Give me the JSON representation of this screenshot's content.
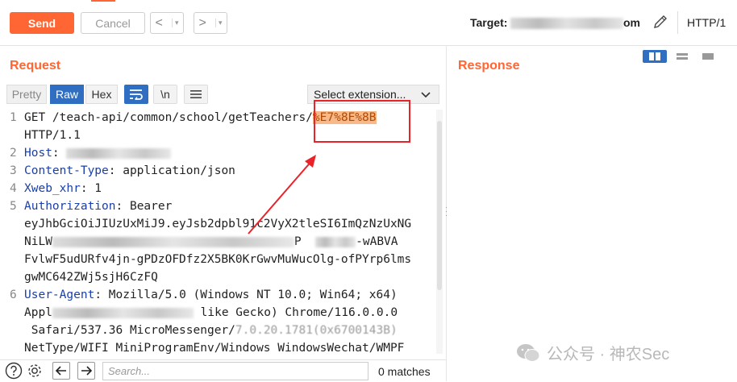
{
  "toolbar": {
    "send_label": "Send",
    "cancel_label": "Cancel",
    "back_glyph": "<",
    "forward_glyph": ">",
    "dropdown_glyph": "▾",
    "target_label": "Target:",
    "target_visible_suffix": "om",
    "http_version": "HTTP/1"
  },
  "layout_toggles": [
    "side-by-side",
    "top-bottom",
    "single"
  ],
  "request": {
    "title": "Request",
    "tabs": {
      "pretty": "Pretty",
      "raw": "Raw",
      "hex": "Hex"
    },
    "active_tab": "Raw",
    "newline_label": "\\n",
    "select_extension": "Select extension...",
    "lines": [
      {
        "num": "1",
        "parts": [
          "GET /teach-api/common/school/getTeachers/",
          "%E7%8E%8B"
        ]
      },
      {
        "num": "",
        "text": "HTTP/1.1"
      },
      {
        "num": "2",
        "header": "Host",
        "value": ":"
      },
      {
        "num": "3",
        "header": "Content-Type",
        "value": ": application/json"
      },
      {
        "num": "4",
        "header": "Xweb_xhr",
        "value": ": 1"
      },
      {
        "num": "5",
        "header": "Authorization",
        "value": ": Bearer"
      },
      {
        "num": "",
        "text": "eyJhbGciOiJIUzUxMiJ9.eyJsb2dpbl91c2VyX2tleSI6ImQzNzUxNG"
      },
      {
        "num": "",
        "text_start": "NiLW",
        "text_end": "P  ",
        "text_tail": "-wABVA"
      },
      {
        "num": "",
        "text": "FvlwF5udURfv4jn-gPDzOFDfz2X5BK0KrGwvMuWucOlg-ofPYrp6lms"
      },
      {
        "num": "",
        "text": "gwMC642ZWj5sjH6CzFQ"
      },
      {
        "num": "6",
        "header": "User-Agent",
        "value": ": Mozilla/5.0 (Windows NT 10.0; Win64; x64)"
      },
      {
        "num": "",
        "text_start": "Appl",
        "text_end": " like Gecko) Chrome/116.0.0.0"
      },
      {
        "num": "",
        "text_start": " Safari/537.36 MicroMessenger/",
        "text_end": "7.0.20.1781(0x6700143B)"
      },
      {
        "num": "",
        "text": "NetType/WIFI MiniProgramEnv/Windows WindowsWechat/WMPF"
      }
    ]
  },
  "response": {
    "title": "Response"
  },
  "bottom": {
    "search_placeholder": "Search...",
    "matches": "0 matches"
  },
  "watermark": {
    "text": "公众号 · 神农Sec"
  },
  "colors": {
    "accent": "#ff6633",
    "active_tab": "#2f6ec1",
    "highlight_bg": "#f7b98a",
    "annotation": "#e8242a",
    "header_name": "#1a3fa8"
  }
}
